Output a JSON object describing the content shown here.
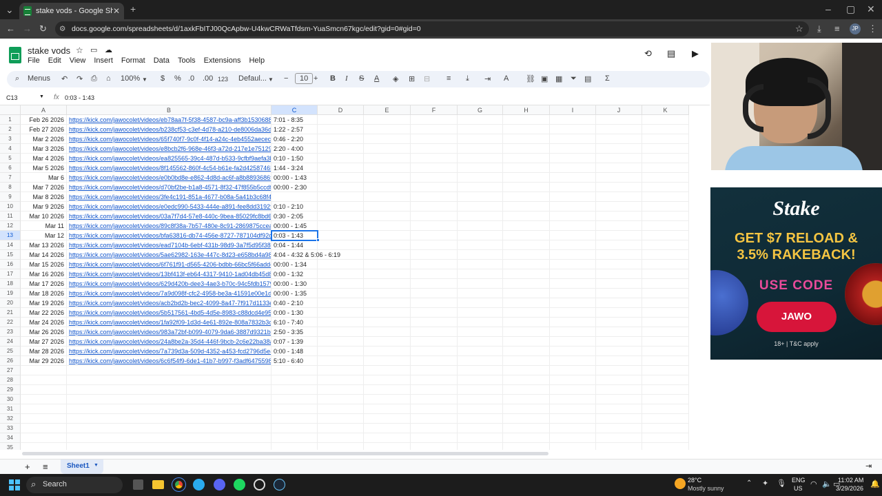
{
  "browser": {
    "tab_title": "stake vods - Google Sheets",
    "url": "docs.google.com/spreadsheets/d/1axkFbITJ00QcApbw-U4kwCRWaTfdsm-YuaSmcn67kgc/edit?gid=0#gid=0",
    "profile": "JP"
  },
  "sheets": {
    "doc_title": "stake vods",
    "menu": [
      "File",
      "Edit",
      "View",
      "Insert",
      "Format",
      "Data",
      "Tools",
      "Extensions",
      "Help"
    ],
    "toolbar": {
      "search": "Menus",
      "zoom": "100%",
      "currency": "$",
      "percent": "%",
      "dec_less": ".0",
      "dec_more": ".00",
      "format_123": "123",
      "font": "Defaul...",
      "font_size": "10"
    },
    "name_box": "C13",
    "formula": "0:03 - 1:43",
    "columns": [
      "A",
      "B",
      "C",
      "D",
      "E",
      "F",
      "G",
      "H",
      "I",
      "J",
      "K"
    ],
    "rows": [
      {
        "a": "Feb 26 2026",
        "b": "https://kick.com/jawocolet/videos/eb78aa7f-5f38-4587-bc9a-aff3b1530688",
        "c": "7:01 - 8:35"
      },
      {
        "a": "Feb 27 2026",
        "b": "https://kick.com/jawocolet/videos/b238cf53-c3ef-4d78-a210-de8006da36d",
        "c": "1:22 - 2:57"
      },
      {
        "a": "Mar 2 2026",
        "b": "https://kick.com/jawocolet/videos/65f740f7-9c0f-4f14-a24c-4eb4552aecec",
        "c": "0:46 - 2:20"
      },
      {
        "a": "Mar 3 2026",
        "b": "https://kick.com/jawocolet/videos/e8bcb2f6-968e-46f3-a72d-217e1e75129",
        "c": "2:20 - 4:00"
      },
      {
        "a": "Mar 4 2026",
        "b": "https://kick.com/jawocolet/videos/ea825565-39c4-487d-b533-9cfbf9aefa3b",
        "c": "0:10 - 1:50"
      },
      {
        "a": "Mar 5 2026",
        "b": "https://kick.com/jawocolet/videos/8f145562-860f-4c54-b61e-fa2d4258746b",
        "c": "1:44 - 3:24"
      },
      {
        "a": "Mar 6",
        "b": "https://kick.com/jawocolet/videos/e0b0bd8e-e862-4d8d-ac6f-a8b8893686f",
        "c": "00:00 - 1:43"
      },
      {
        "a": "Mar 7 2026",
        "b": "https://kick.com/jawocolet/videos/d70bf2be-b1a8-4571-8f32-47f855b5ccdf",
        "c": "00:00 - 2:30"
      },
      {
        "a": "Mar 8 2026",
        "b": "https://kick.com/jawocolet/videos/3fe4c191-851a-4677-b08a-5a41b3c68f47",
        "c": ""
      },
      {
        "a": "Mar 9 2026",
        "b": "https://kick.com/jawocolet/videos/e0edc990-5433-444e-a891-fee8dd31929",
        "c": "0:10 - 2:10"
      },
      {
        "a": "Mar 10 2026",
        "b": "https://kick.com/jawocolet/videos/03a7f7d4-57e8-440c-9bea-85029fc8bd6",
        "c": "0:30 - 2:05"
      },
      {
        "a": "Mar 11",
        "b": "https://kick.com/jawocolet/videos/89c8f38a-7b57-480e-8c91-2869875ccea",
        "c": "00:00 - 1:45"
      },
      {
        "a": "Mar 12",
        "b": "https://kick.com/jawocolet/videos/bfa63816-db74-456e-8727-787104df92d",
        "c": "0:03 - 1:43"
      },
      {
        "a": "Mar 13 2026",
        "b": "https://kick.com/jawocolet/videos/ead7104b-6ebf-431b-98d9-3a7f5d95f38a",
        "c": "0:04 - 1:44"
      },
      {
        "a": "Mar 14 2026",
        "b": "https://kick.com/jawocolet/videos/5ae62982-163e-447c-8d23-e658bd4a98",
        "c": "4:04 - 4:32 & 5:06 - 6:19"
      },
      {
        "a": "Mar 15 2026",
        "b": "https://kick.com/jawocolet/videos/6f761f91-d565-4206-bdbb-66bc5f66adde",
        "c": "00:00 - 1:34"
      },
      {
        "a": "Mar 16 2026",
        "b": "https://kick.com/jawocolet/videos/13bf413f-eb64-4317-9410-1ad04db45d8",
        "c": "0:00 - 1:32"
      },
      {
        "a": "Mar 17 2026",
        "b": "https://kick.com/jawocolet/videos/629d420b-dee3-4ae3-b70c-94c5fdb1579",
        "c": "00:00 - 1:30"
      },
      {
        "a": "Mar 18 2026",
        "b": "https://kick.com/jawocolet/videos/7a9d098f-cfc2-4958-be3a-41591e00e1da",
        "c": "00:00 - 1:35"
      },
      {
        "a": "Mar 19 2026",
        "b": "https://kick.com/jawocolet/videos/acb2bd2b-bec2-4099-8a47-7f917d1133e",
        "c": "0:40 - 2:10"
      },
      {
        "a": "Mar 22 2026",
        "b": "https://kick.com/jawocolet/videos/5b517561-4bd5-4d5e-8983-c88dcd4e95b",
        "c": "0:00 - 1:30"
      },
      {
        "a": "Mar 24 2026",
        "b": "https://kick.com/jawocolet/videos/1fa92f09-1d3d-4e61-892e-808a7832b3c",
        "c": "6:10 - 7:40"
      },
      {
        "a": "Mar 26 2026",
        "b": "https://kick.com/jawocolet/videos/983a72bf-b099-4079-9da6-3887d9321b7",
        "c": "2:50 - 3:35"
      },
      {
        "a": "Mar 27 2026",
        "b": "https://kick.com/jawocolet/videos/24a8be2a-35d4-446f-9bcb-2c6e22ba38a",
        "c": "0:07 - 1:39"
      },
      {
        "a": "Mar 28 2026",
        "b": "https://kick.com/jawocolet/videos/7a739d3a-509d-4352-a453-fcd2796d5e4",
        "c": "0:00 - 1:48"
      },
      {
        "a": "Mar 29 2026",
        "b": "https://kick.com/jawocolet/videos/6c6f54f9-6de1-41b7-b997-f3adf6475598",
        "c": "5:10 - 6:40"
      }
    ],
    "total_rows": 35,
    "selected_row": 13,
    "sheet_tab": "Sheet1"
  },
  "ad": {
    "brand": "Stake",
    "headline1": "GET $7 RELOAD &",
    "headline2": "3.5% RAKEBACK!",
    "use_code": "USE CODE",
    "code": "JAWO",
    "terms": "18+ | T&C apply"
  },
  "taskbar": {
    "search": "Search",
    "weather_temp": "28°C",
    "weather_desc": "Mostly sunny",
    "lang1": "ENG",
    "lang2": "US",
    "time": "11:02 AM",
    "date": "3/29/2026"
  }
}
